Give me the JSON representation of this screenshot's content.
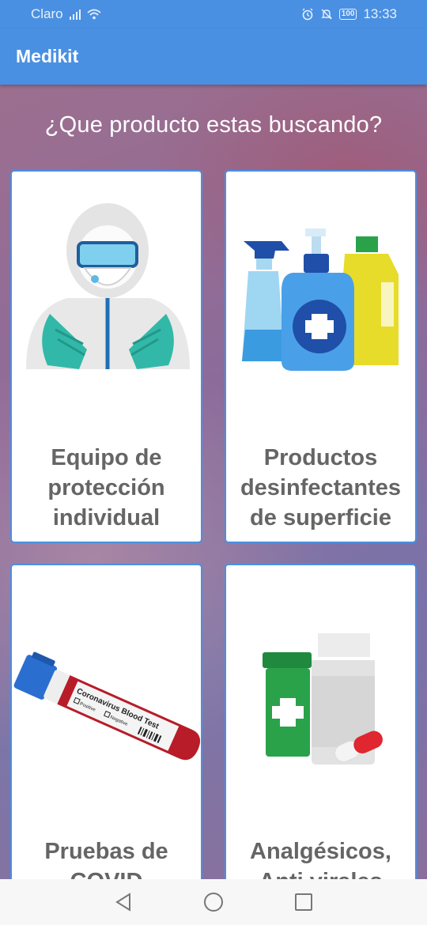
{
  "status_bar": {
    "carrier": "Claro",
    "battery": "100",
    "time": "13:33",
    "icons": [
      "signal-icon",
      "wifi-icon",
      "alarm-icon",
      "mute-icon",
      "battery-icon"
    ]
  },
  "app_bar": {
    "title": "Medikit"
  },
  "main": {
    "heading": "¿Que producto estas buscando?",
    "categories": [
      {
        "label": "Equipo de protección individual",
        "icon": "ppe-suit-icon"
      },
      {
        "label": "Productos desinfectantes de superficie",
        "icon": "disinfectant-bottles-icon"
      },
      {
        "label": "Pruebas de COVID",
        "icon": "blood-test-tube-icon"
      },
      {
        "label": "Analgésicos, Anti virales",
        "icon": "medicine-bottles-icon"
      }
    ],
    "tube_label": {
      "title": "Coronavirus Blood Test",
      "positive": "Positive",
      "negative": "Negative"
    }
  },
  "nav_bar": {
    "icons": [
      "back-icon",
      "home-icon",
      "recents-icon"
    ]
  },
  "colors": {
    "primary": "#4a90e2",
    "label_text": "#656565",
    "nav_bg": "#f7f7f7"
  }
}
